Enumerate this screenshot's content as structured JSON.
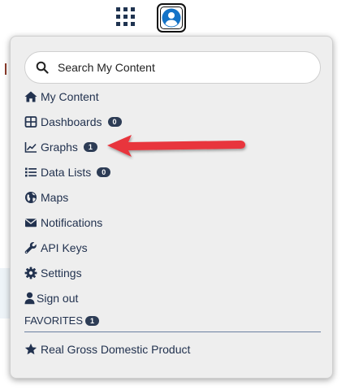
{
  "header": {
    "apps_icon": "grid-icon",
    "avatar_icon": "user-circle-icon"
  },
  "search": {
    "placeholder": "Search My Content",
    "icon": "search-icon"
  },
  "menu": {
    "items": [
      {
        "label": "My Content",
        "icon": "home-icon"
      },
      {
        "label": "Dashboards",
        "icon": "dashboard-icon",
        "badge": "0"
      },
      {
        "label": "Graphs",
        "icon": "line-chart-icon",
        "badge": "1"
      },
      {
        "label": "Data Lists",
        "icon": "list-icon",
        "badge": "0"
      },
      {
        "label": "Maps",
        "icon": "globe-icon"
      },
      {
        "label": "Notifications",
        "icon": "envelope-icon"
      },
      {
        "label": "API Keys",
        "icon": "wrench-icon"
      },
      {
        "label": "Settings",
        "icon": "gear-icon"
      },
      {
        "label": "Sign out",
        "icon": "user-icon"
      }
    ]
  },
  "favorites": {
    "header": "FAVORITES",
    "badge": "1",
    "items": [
      {
        "label": "Real Gross Domestic Product",
        "icon": "star-icon"
      }
    ]
  },
  "annotation": {
    "arrow_color": "#e8363c"
  },
  "colors": {
    "text": "#22324f",
    "badge": "#2d3c55",
    "avatar": "#1473c7"
  }
}
